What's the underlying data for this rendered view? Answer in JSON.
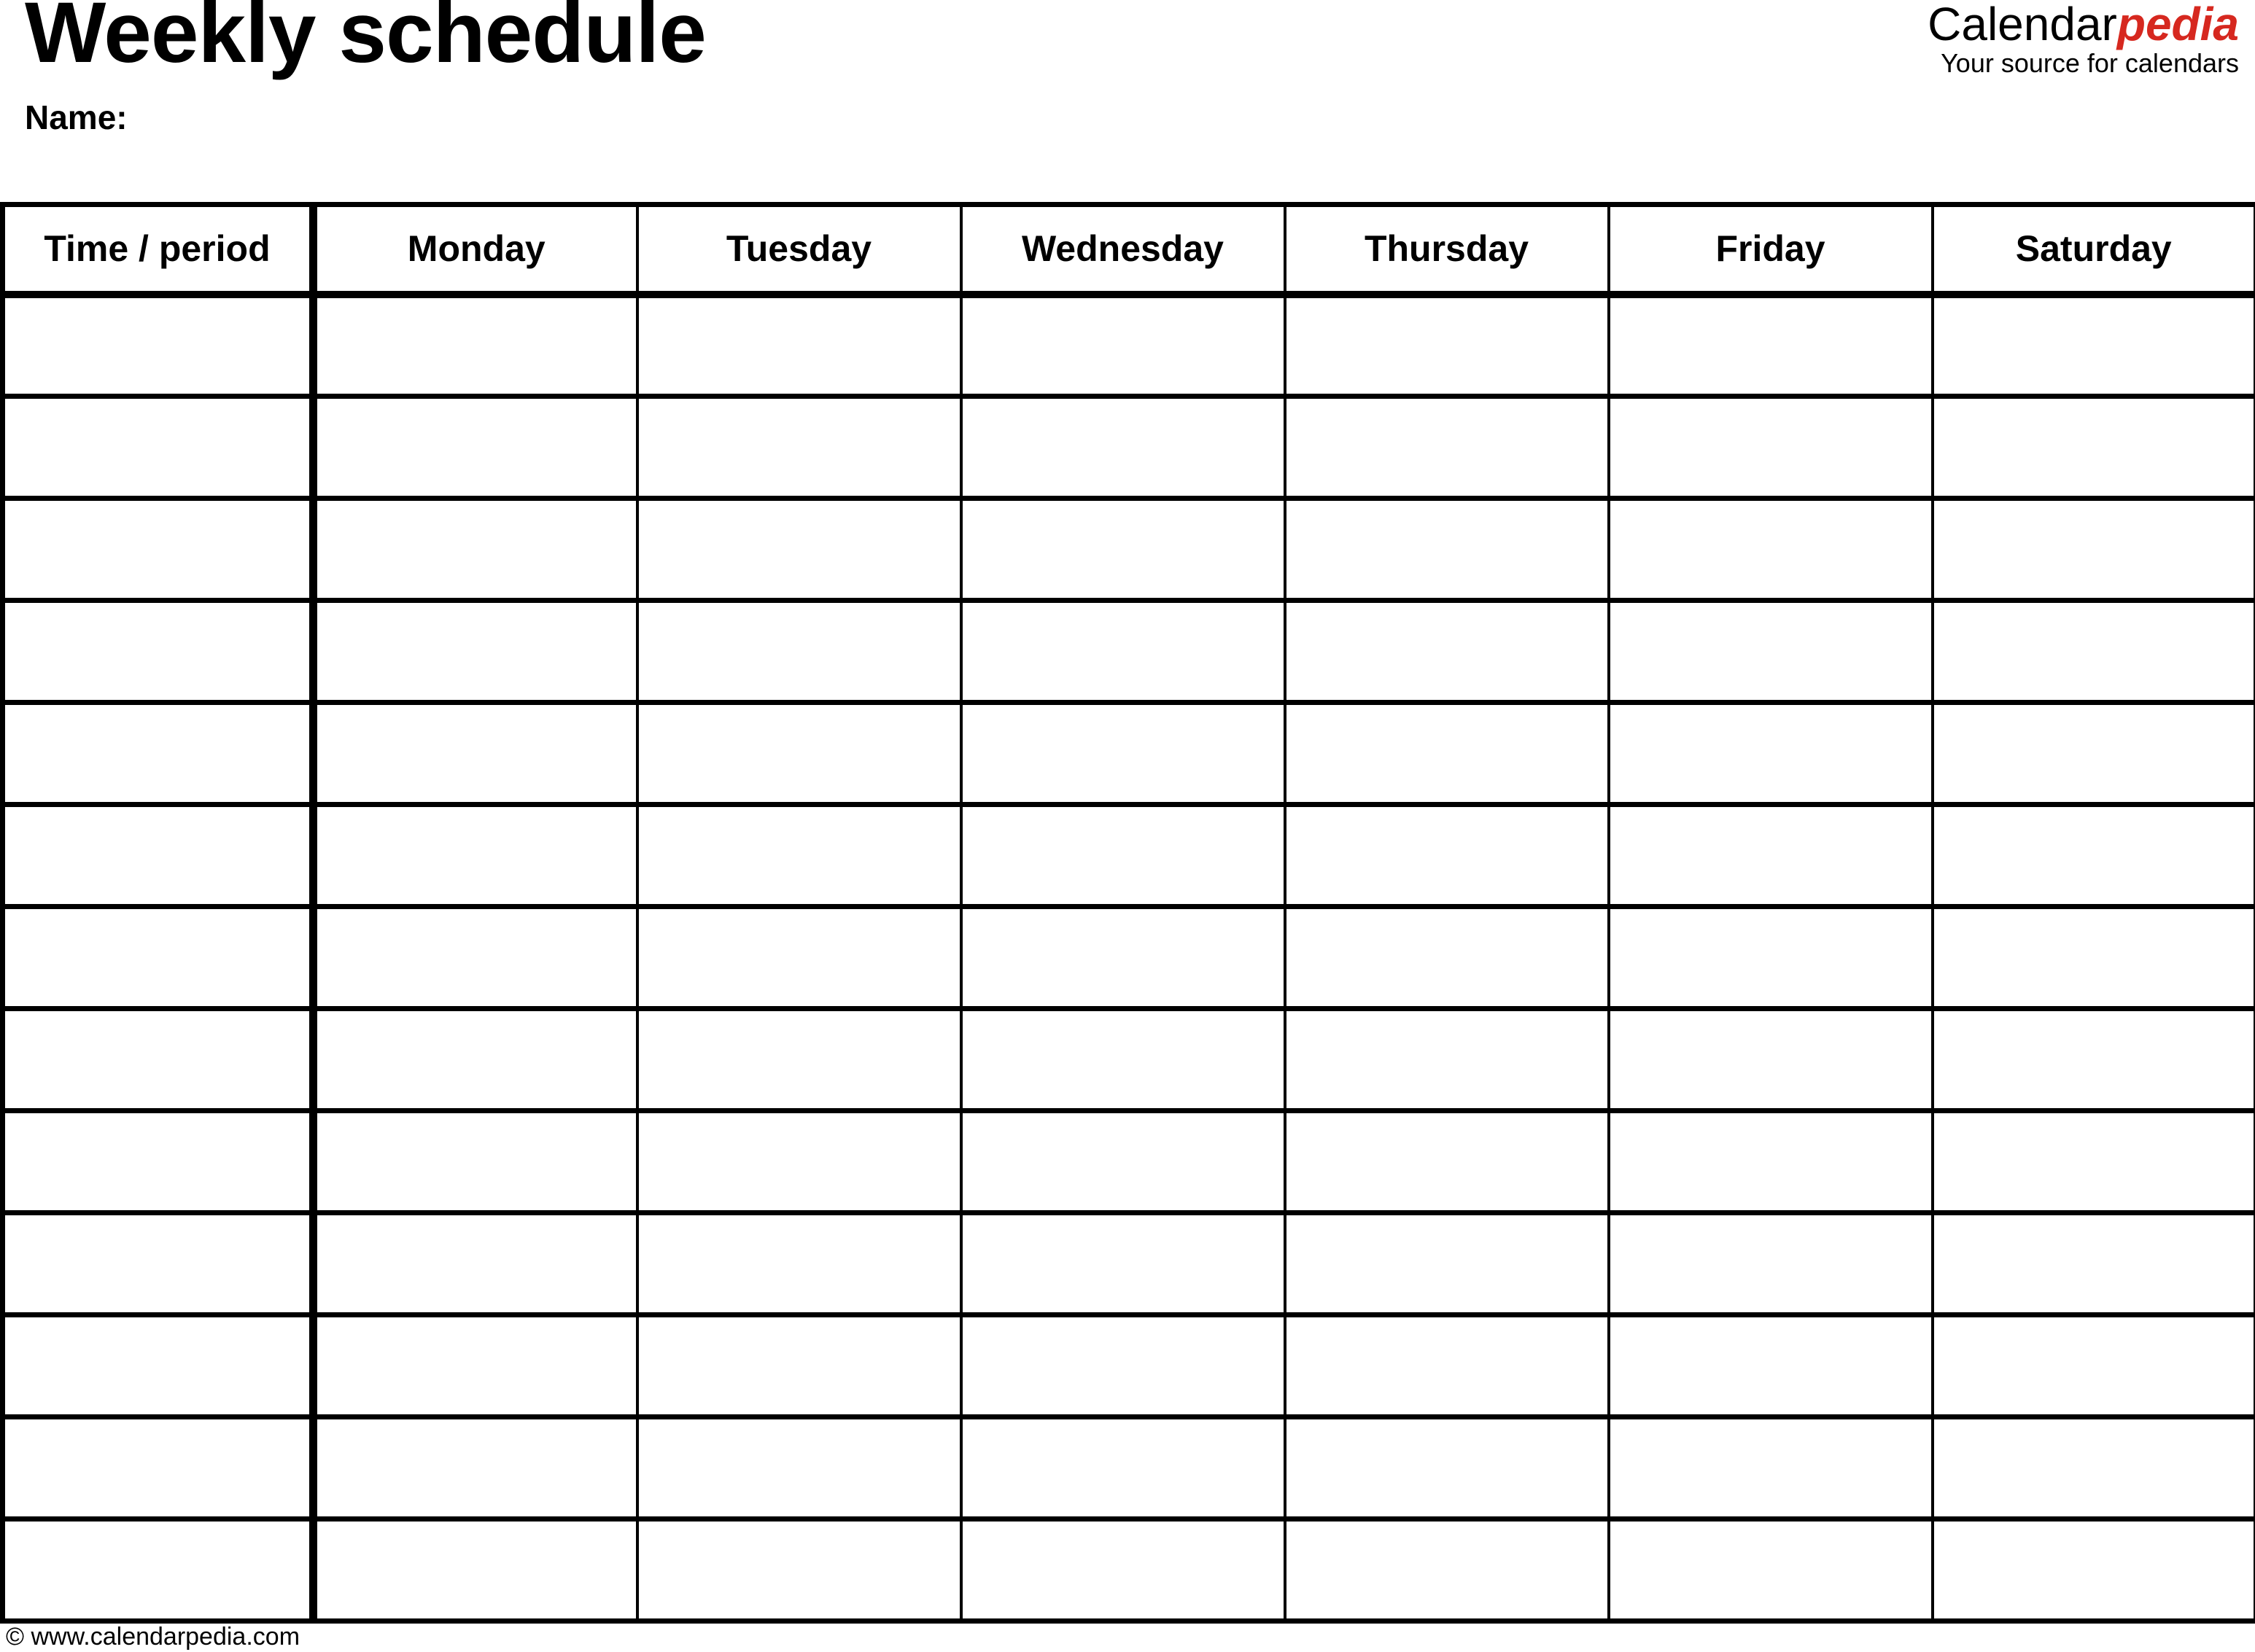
{
  "document": {
    "title": "Weekly schedule",
    "name_label": "Name:"
  },
  "brand": {
    "word_primary": "Calendar",
    "word_accent": "pedia",
    "tagline": "Your source for calendars",
    "accent_color": "#d6281f"
  },
  "table": {
    "columns": [
      "Time / period",
      "Monday",
      "Tuesday",
      "Wednesday",
      "Thursday",
      "Friday",
      "Saturday"
    ],
    "row_count": 13,
    "rows": [
      [
        "",
        "",
        "",
        "",
        "",
        "",
        ""
      ],
      [
        "",
        "",
        "",
        "",
        "",
        "",
        ""
      ],
      [
        "",
        "",
        "",
        "",
        "",
        "",
        ""
      ],
      [
        "",
        "",
        "",
        "",
        "",
        "",
        ""
      ],
      [
        "",
        "",
        "",
        "",
        "",
        "",
        ""
      ],
      [
        "",
        "",
        "",
        "",
        "",
        "",
        ""
      ],
      [
        "",
        "",
        "",
        "",
        "",
        "",
        ""
      ],
      [
        "",
        "",
        "",
        "",
        "",
        "",
        ""
      ],
      [
        "",
        "",
        "",
        "",
        "",
        "",
        ""
      ],
      [
        "",
        "",
        "",
        "",
        "",
        "",
        ""
      ],
      [
        "",
        "",
        "",
        "",
        "",
        "",
        ""
      ],
      [
        "",
        "",
        "",
        "",
        "",
        "",
        ""
      ],
      [
        "",
        "",
        "",
        "",
        "",
        "",
        ""
      ]
    ]
  },
  "footer": {
    "copyright": "© www.calendarpedia.com"
  }
}
